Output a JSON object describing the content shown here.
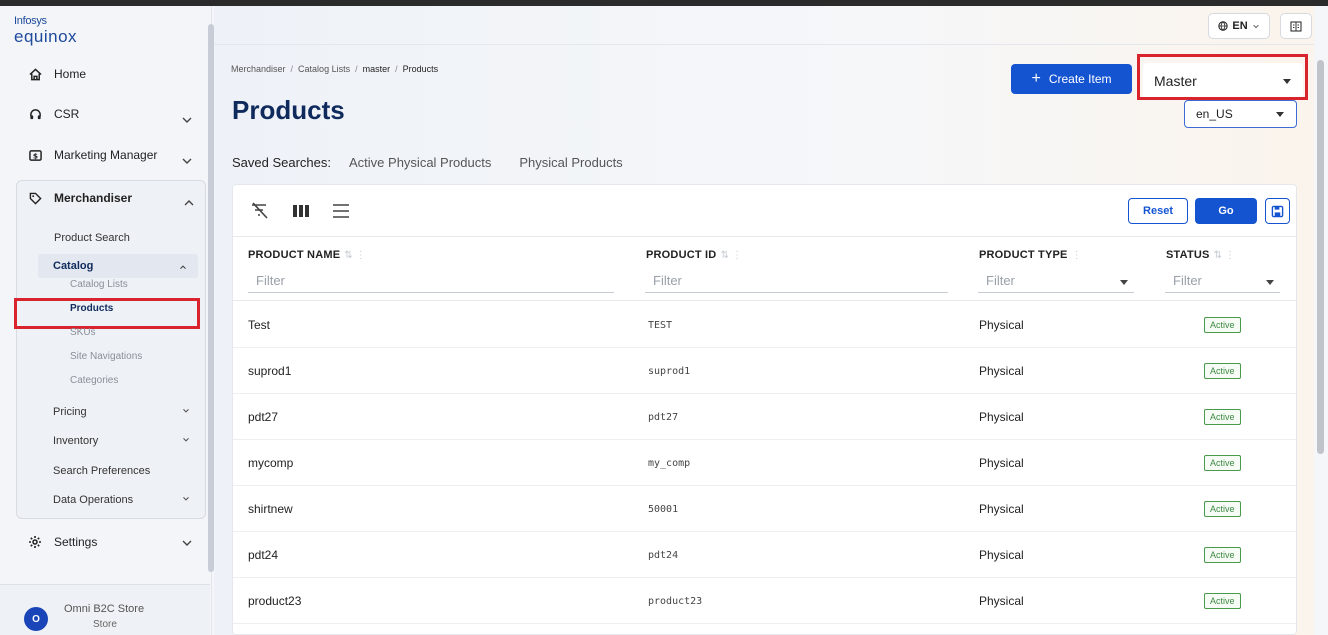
{
  "logo": {
    "line1": "Infosys",
    "line2": "equinox"
  },
  "sidebar": {
    "items": [
      {
        "label": "Home",
        "icon": "home-icon"
      },
      {
        "label": "CSR",
        "icon": "headset-icon"
      },
      {
        "label": "Marketing Manager",
        "icon": "dollar-icon"
      },
      {
        "label": "Merchandiser",
        "icon": "tag-icon"
      },
      {
        "label": "Settings",
        "icon": "gear-icon"
      }
    ],
    "merchandiser": {
      "product_search": "Product Search",
      "catalog": "Catalog",
      "catalog_children": [
        "Catalog Lists",
        "Products",
        "SKUs",
        "Site Navigations",
        "Categories"
      ],
      "pricing": "Pricing",
      "inventory": "Inventory",
      "search_preferences": "Search Preferences",
      "data_operations": "Data Operations"
    },
    "user": {
      "avatar": "O",
      "name": "Omni B2C Store",
      "role": "Store"
    }
  },
  "header": {
    "language": "EN"
  },
  "breadcrumb": [
    "Merchandiser",
    "Catalog Lists",
    "master",
    "Products"
  ],
  "page": {
    "title": "Products",
    "create_button": "Create Item",
    "catalog_select": "Master",
    "locale_select": "en_US"
  },
  "saved_searches": {
    "label": "Saved Searches:",
    "options": [
      "Active Physical Products",
      "Physical Products"
    ]
  },
  "toolbar": {
    "reset": "Reset",
    "go": "Go"
  },
  "table": {
    "columns": [
      "PRODUCT NAME",
      "PRODUCT ID",
      "PRODUCT TYPE",
      "STATUS"
    ],
    "filter_placeholder": "Filter",
    "rows": [
      {
        "name": "Test",
        "id": "TEST",
        "type": "Physical",
        "status": "Active"
      },
      {
        "name": "suprod1",
        "id": "suprod1",
        "type": "Physical",
        "status": "Active"
      },
      {
        "name": "pdt27",
        "id": "pdt27",
        "type": "Physical",
        "status": "Active"
      },
      {
        "name": "mycomp",
        "id": "my_comp",
        "type": "Physical",
        "status": "Active"
      },
      {
        "name": "shirtnew",
        "id": "50001",
        "type": "Physical",
        "status": "Active"
      },
      {
        "name": "pdt24",
        "id": "pdt24",
        "type": "Physical",
        "status": "Active"
      },
      {
        "name": "product23",
        "id": "product23",
        "type": "Physical",
        "status": "Active"
      }
    ]
  },
  "colors": {
    "primary": "#1554d1",
    "highlight": "#d9232d",
    "title": "#0f2a5c",
    "active": "#3d8a41"
  }
}
